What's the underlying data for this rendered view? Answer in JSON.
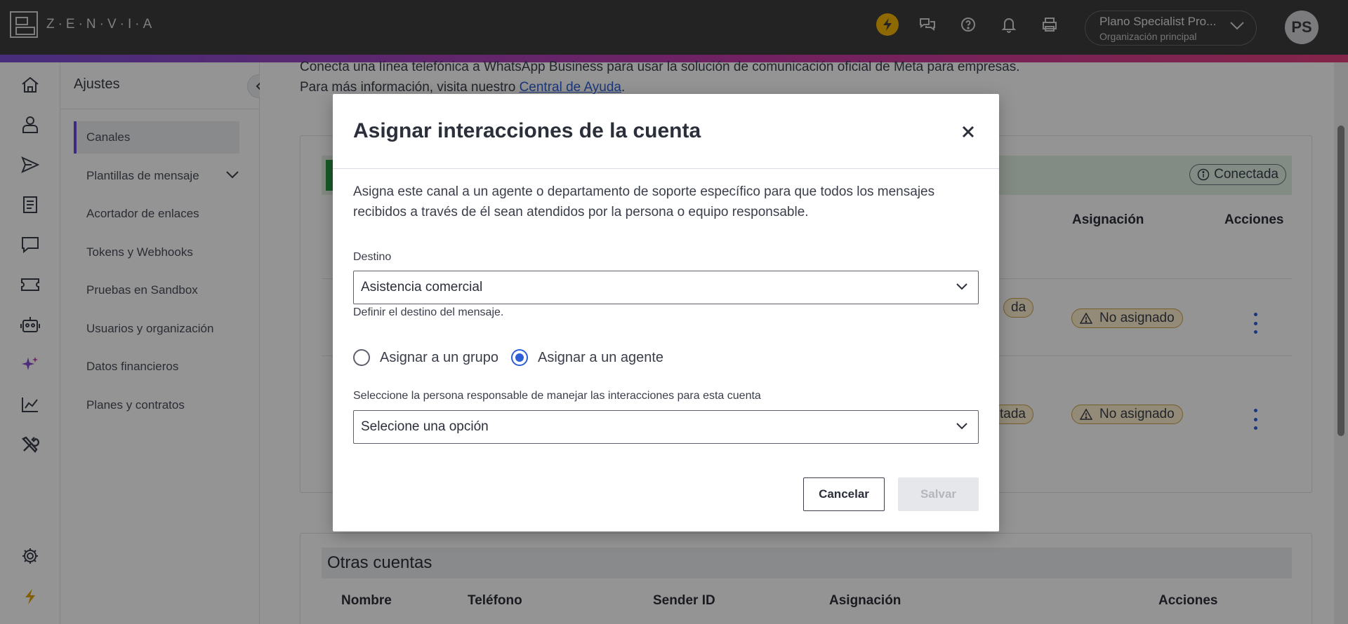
{
  "app": {
    "brand": "Z·E·N·V·I·A",
    "org_name": "Plano Specialist Pro...",
    "org_sub": "Organización principal",
    "avatar_initials": "PS"
  },
  "sidebar": {
    "title": "Ajustes",
    "items": [
      {
        "label": "Canales"
      },
      {
        "label": "Plantillas de mensaje"
      },
      {
        "label": "Acortador de enlaces"
      },
      {
        "label": "Tokens y Webhooks"
      },
      {
        "label": "Pruebas en Sandbox"
      },
      {
        "label": "Usuarios y organización"
      },
      {
        "label": "Datos financieros"
      },
      {
        "label": "Planes y contratos"
      }
    ]
  },
  "main": {
    "intro_line1": "Conecta una línea telefónica a WhatsApp Business para usar la solución de comunicación oficial de Meta para empresas.",
    "intro_line2_prefix": "Para más información, visita nuestro ",
    "intro_link": "Central de Ayuda",
    "intro_line2_suffix": ".",
    "status_label": "Conectada",
    "table_headers": {
      "asignacion": "Asignación",
      "acciones": "Acciones"
    },
    "rows": [
      {
        "status_partial": "da",
        "assignment": "No asignado"
      },
      {
        "status_partial": "tada",
        "assignment": "No asignado"
      }
    ],
    "other_accounts": {
      "title": "Otras cuentas",
      "headers": [
        "Nombre",
        "Teléfono",
        "Sender ID",
        "Asignación",
        "Acciones"
      ]
    }
  },
  "modal": {
    "title": "Asignar interacciones de la cuenta",
    "description": "Asigna este canal a un agente o departamento de soporte específico para que todos los mensajes recibidos a través de él sean atendidos por la persona o equipo responsable.",
    "destino_label": "Destino",
    "destino_value": "Asistencia comercial",
    "destino_helper": "Definir el destino del mensaje.",
    "radio_group_label": "Asignar a un grupo",
    "radio_agent_label": "Asignar a un agente",
    "radio_selected": "agent",
    "responsable_label": "Seleccione la persona responsable de manejar las interacciones para esta cuenta",
    "responsable_placeholder": "Selecione una opción",
    "cancel_label": "Cancelar",
    "save_label": "Salvar"
  }
}
